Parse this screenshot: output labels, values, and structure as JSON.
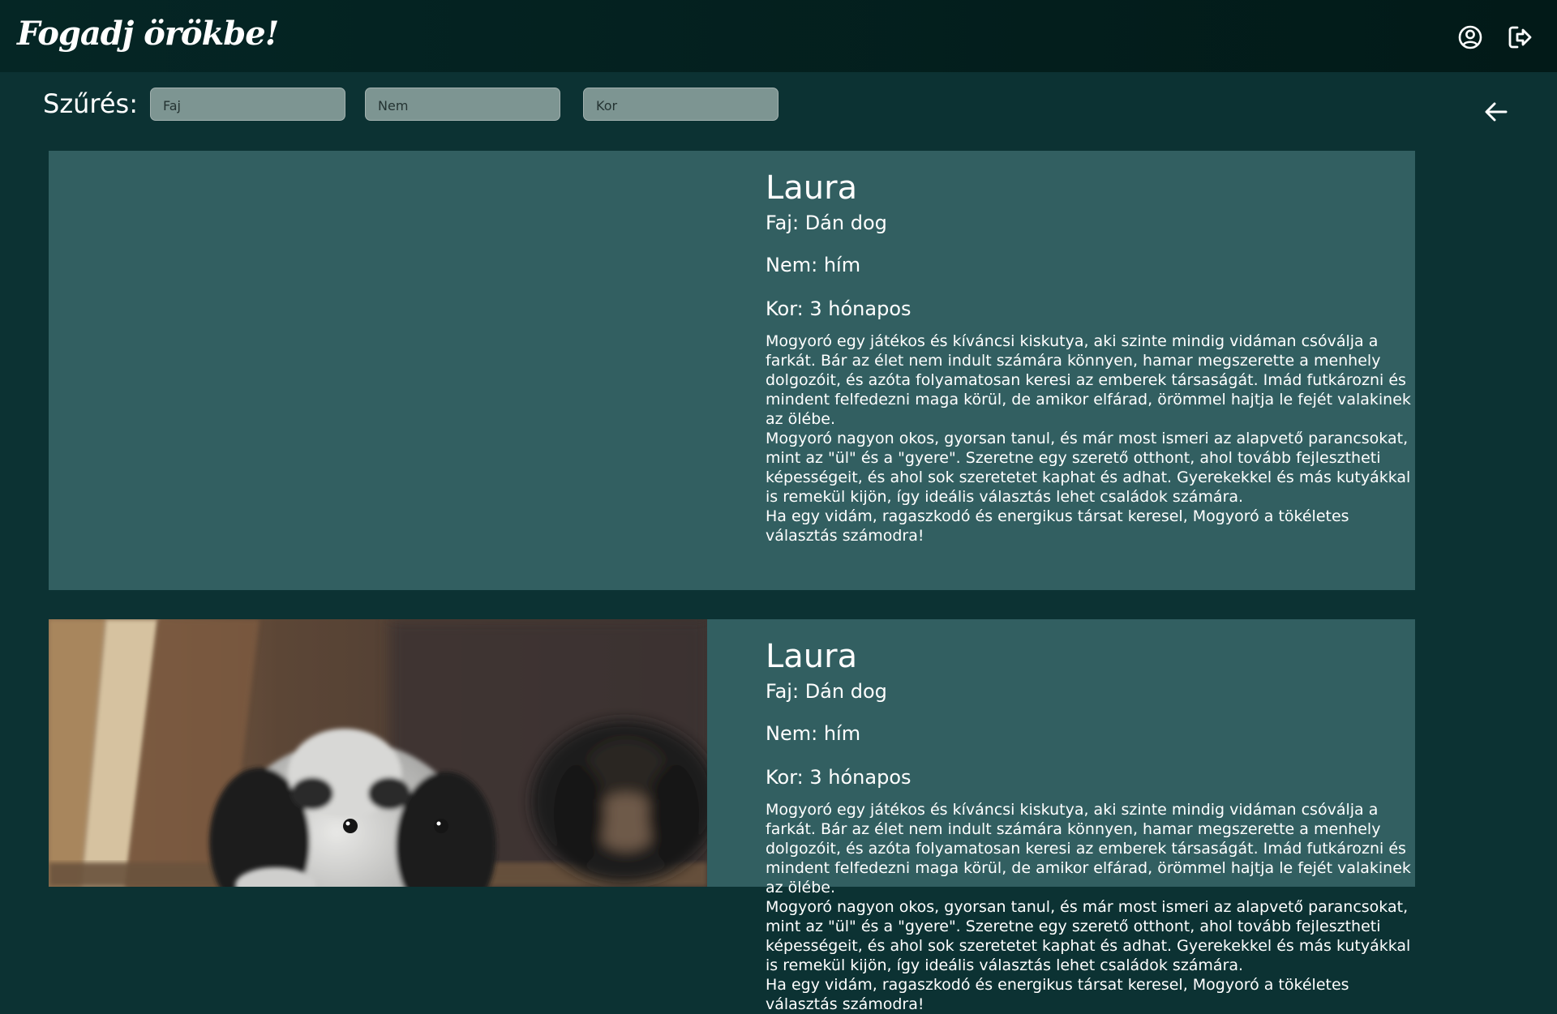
{
  "header": {
    "logo": "Fogadj örökbe!",
    "icons": [
      "user-circle-icon",
      "logout-icon"
    ]
  },
  "filter": {
    "label": "Szűrés:",
    "species_placeholder": "Faj",
    "gender_placeholder": "Nem",
    "age_placeholder": "Kor"
  },
  "colors": {
    "header_bg": "#031e1c",
    "page_bg": "#0c3233",
    "card_bg": "#325f61",
    "input_bg": "#7d9592"
  },
  "animals": [
    {
      "name": "Laura",
      "species": "Faj: Dán dog",
      "gender": "Nem: hím",
      "age": "Kor: 3 hónapos",
      "description": "Mogyoró egy játékos és kíváncsi kiskutya, aki szinte mindig vidáman csóválja a farkát. Bár az élet nem indult számára könnyen, hamar megszerette a menhely dolgozóit, és azóta folyamatosan keresi az emberek társaságát. Imád futkározni és mindent felfedezni maga körül, de amikor elfárad, örömmel hajtja le fejét valakinek az ölébe.\nMogyoró nagyon okos, gyorsan tanul, és már most ismeri az alapvető parancsokat, mint az \"ül\" és a \"gyere\". Szeretne egy szerető otthont, ahol tovább fejlesztheti képességeit, és ahol sok szeretetet kaphat és adhat. Gyerekekkel és más kutyákkal is remekül kijön, így ideális választás lehet családok számára.\nHa egy vidám, ragaszkodó és energikus társat keresel, Mogyoró a tökéletes választás számodra!",
      "photo": "none"
    },
    {
      "name": "Laura",
      "species": "Faj: Dán dog",
      "gender": "Nem: hím",
      "age": "Kor: 3 hónapos",
      "description": "Mogyoró egy játékos és kíváncsi kiskutya, aki szinte mindig vidáman csóválja a farkát. Bár az élet nem indult számára könnyen, hamar megszerette a menhely dolgozóit, és azóta folyamatosan keresi az emberek társaságát. Imád futkározni és mindent felfedezni maga körül, de amikor elfárad, örömmel hajtja le fejét valakinek az ölébe.\nMogyoró nagyon okos, gyorsan tanul, és már most ismeri az alapvető parancsokat, mint az \"ül\" és a \"gyere\". Szeretne egy szerető otthont, ahol tovább fejlesztheti képességeit, és ahol sok szeretetet kaphat és adhat. Gyerekekkel és más kutyákkal is remekül kijön, így ideális választás lehet családok számára.\nHa egy vidám, ragaszkodó és energikus társat keresel, Mogyoró a tökéletes választás számodra!",
      "photo": "puppies-photo"
    }
  ]
}
